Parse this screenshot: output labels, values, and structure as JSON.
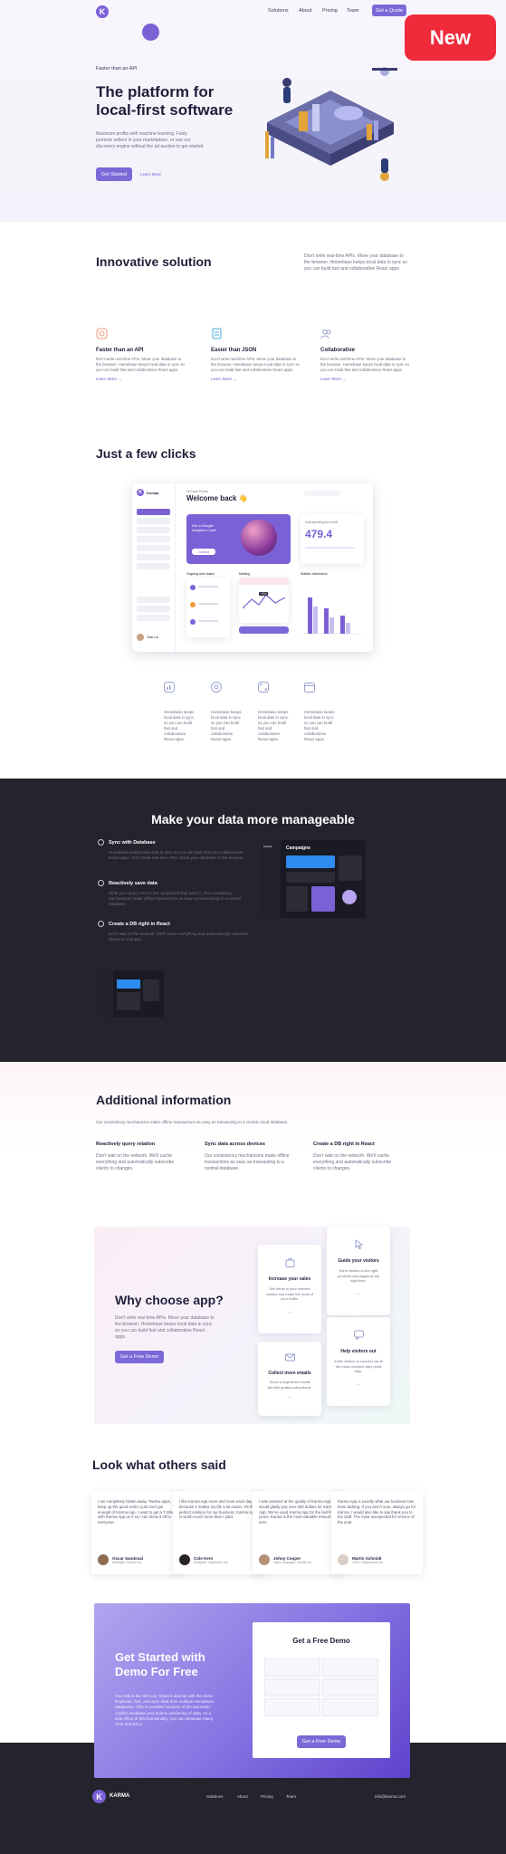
{
  "header": {
    "nav": [
      "Solutions",
      "About",
      "Pricing",
      "Team"
    ],
    "cta": "Get a Quote",
    "badge": "New"
  },
  "hero": {
    "kicker": "Faster than an API",
    "title_line1": "The platform for",
    "title_line2": "local-first software",
    "desc": "Maximize profits with machine learning. Fairly promote sellers in your marketplace, or use our discovery engine without the ad auction to get started.",
    "primary": "Get Started",
    "secondary": "Learn More"
  },
  "innovative": {
    "title": "Innovative solution",
    "desc": "Don't write real-time APIs. Move your database to the browser. Homebase keeps local data in sync so you can build fast and collaborative React apps.",
    "features": [
      {
        "title": "Faster than an API",
        "desc": "Don't write real-time APIs. Move your database to the browser. Homebase keeps local data in sync so you can build fast and collaborative React apps.",
        "link": "Learn More →",
        "icon": "cube-icon"
      },
      {
        "title": "Easier than JSON",
        "desc": "Don't write real-time APIs. Move your database to the browser. Homebase keeps local data in sync so you can build fast and collaborative React apps.",
        "link": "Learn More →",
        "icon": "document-icon"
      },
      {
        "title": "Collaborative",
        "desc": "Don't write real-time APIs. Move your database to the browser. Homebase keeps local data in sync so you can build fast and collaborative React apps.",
        "link": "Learn More →",
        "icon": "people-icon"
      }
    ]
  },
  "clicks": {
    "title": "Just a few clicks",
    "dashboard": {
      "brand": "Kumaa",
      "greeting": "Hi Farm Pixels,",
      "welcome": "Welcome back 👋",
      "promo_title": "Get a Google Analytics Code",
      "promo_btn": "Contact",
      "stat_label": "Card spending this month",
      "stat_value": "479.4",
      "metric": "+5.6",
      "section1": "Ongoing work status",
      "section2": "Meeting",
      "section3": "Statistic information",
      "user_name": "Taav Lai"
    },
    "items": [
      {
        "text": "Homebase keeps local data in sync so you can build fast and collaborative React apps.",
        "icon": "chart-icon"
      },
      {
        "text": "Homebase keeps local data in sync so you can build fast and collaborative React apps.",
        "icon": "target-icon"
      },
      {
        "text": "Homebase keeps local data in sync so you can build fast and collaborative React apps.",
        "icon": "expand-icon"
      },
      {
        "text": "Homebase keeps local data in sync so you can build fast and collaborative React apps.",
        "icon": "calendar-icon"
      }
    ]
  },
  "manageable": {
    "title": "Make your data more manageable",
    "features": [
      {
        "title": "Sync with Database",
        "desc": "Homebase keeps local data in sync so you can build fast and collaborative React apps. Don't write real-time APIs. Move your database to the browser."
      },
      {
        "title": "Reactively save data",
        "desc": "Write your query next to the component that uses it. The consistency mechanisms make offline transactions as easy as transacting to a central database."
      },
      {
        "title": "Create a DB right in React",
        "desc": "Don't wait on the network. We'll cache everything and automatically subscribe clients to changes."
      }
    ],
    "mock_title": "Campaigns",
    "mock_brand": "Kumaa"
  },
  "additional": {
    "title": "Additional information",
    "desc": "Our consistency mechanisms make offline transactions as easy as transacting to a central cloud database.",
    "cols": [
      {
        "title": "Reactively query relation",
        "desc": "Don't wait on the network. We'll cache everything and automatically subscribe clients to changes."
      },
      {
        "title": "Sync data across devices",
        "desc": "Our consistency mechanisms make offline transactions as easy as transacting to a central database."
      },
      {
        "title": "Create a DB right in React",
        "desc": "Don't wait on the network. We'll cache everything and automatically subscribe clients to changes."
      }
    ]
  },
  "why": {
    "title": "Why choose app?",
    "desc": "Don't write real-time APIs. Move your database to the browser. Homebase keeps local data in sync so you can build fast and collaborative React apps.",
    "btn": "Get a Free Demo",
    "cards": [
      {
        "title": "Increase your sales",
        "desc": "Sell items to your website visitors and make the most of your traffic.",
        "icon": "bag-icon"
      },
      {
        "title": "Guide your visitors",
        "desc": "Send visitors to the right products and pages at the right time.",
        "icon": "pointer-icon"
      },
      {
        "title": "Collect more emails",
        "desc": "Show a segmented email list with quality subscribers.",
        "icon": "mail-icon"
      },
      {
        "title": "Help visitors out",
        "desc": "Invite visitors to connect via at the exact moment they need help.",
        "icon": "chat-icon"
      }
    ]
  },
  "testimonials": {
    "title": "Look what others said",
    "items": [
      {
        "quote": "I am completely blown away. Twelve apps, keep up the good work! I just can't get enough of Karma App. I want to get a T-Shirt with Karma App on it so I can show it off to everyone.",
        "name": "Oscar Sandoval",
        "role": "Manager, Nordic Inc."
      },
      {
        "quote": "I like Karma App more and more each day because it makes my life a lot easier. It's the perfect solution for our business. Karma App is worth much more than I paid.",
        "name": "Cole Kern",
        "role": "Designer, Synthesis Inc."
      },
      {
        "quote": "I was amazed at the quality of Karma App. I would gladly pay over 600 dollars for Karma App. We've used Karma App for the last five years. Karma is the most valuable resource ever.",
        "name": "Johny Cooper",
        "role": "Sales manager, Nordic Inc."
      },
      {
        "quote": "Karma App is exactly what our business has been lacking. If you aren't sure, always go for Karma. I would also like to say thank you to the staff. The most unexpected for service of the year.",
        "name": "Martin Schmidt",
        "role": "CEO, Objectword Inc."
      }
    ]
  },
  "cta": {
    "title": "Get Started with Demo For Free",
    "desc": "Your DB in the DB now. Share it directly with the client. Replicate, fork, and sync data from multiple Homebase databases. This is possible because of the automatic conflict resolution and built-in versioning of data. As a side effect of this functionality, you can eliminate many APIs and ETLs.",
    "form_title": "Get a Free Demo",
    "form_btn": "Get a Free Demo"
  },
  "footer": {
    "brand": "KARMA",
    "nav": [
      "Solutions",
      "About",
      "Pricing",
      "Team"
    ],
    "email": "info@karma.com"
  },
  "colors": {
    "accent": "#7b61d6",
    "dark": "#24242f",
    "badge": "#ef2b3b"
  }
}
